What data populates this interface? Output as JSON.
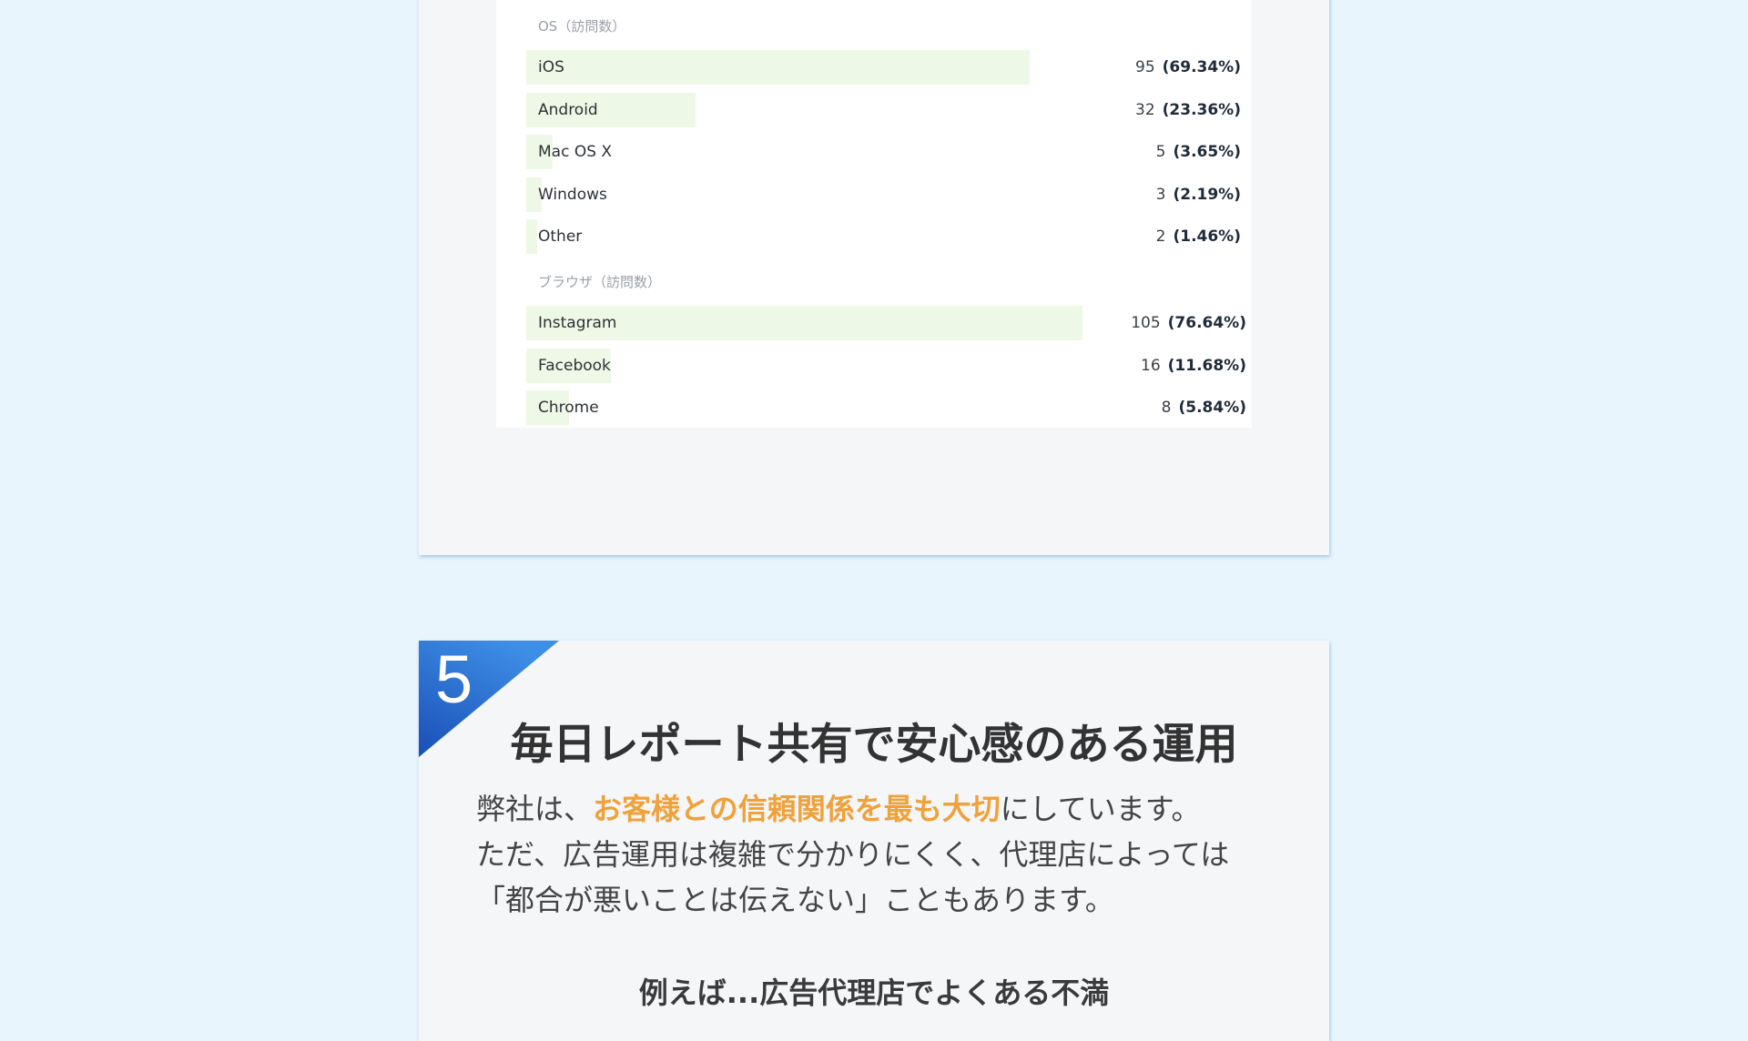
{
  "stats": {
    "os_label": "OS（訪問数）",
    "os_rows": [
      {
        "name": "iOS",
        "count": "95",
        "pct": "(69.34%)",
        "share": 0.6934
      },
      {
        "name": "Android",
        "count": "32",
        "pct": "(23.36%)",
        "share": 0.2336
      },
      {
        "name": "Mac OS X",
        "count": "5",
        "pct": "(3.65%)",
        "share": 0.0365
      },
      {
        "name": "Windows",
        "count": "3",
        "pct": "(2.19%)",
        "share": 0.0219
      },
      {
        "name": "Other",
        "count": "2",
        "pct": "(1.46%)",
        "share": 0.0146
      }
    ],
    "browser_label": "ブラウザ（訪問数）",
    "browser_rows": [
      {
        "name": "Instagram",
        "count": "105",
        "pct": "(76.64%)",
        "share": 0.7664
      },
      {
        "name": "Facebook",
        "count": "16",
        "pct": "(11.68%)",
        "share": 0.1168
      },
      {
        "name": "Chrome",
        "count": "8",
        "pct": "(5.84%)",
        "share": 0.0584
      }
    ]
  },
  "feature": {
    "number": "5",
    "title": "毎日レポート共有で安心感のある運用",
    "body_prefix": "弊社は、",
    "body_highlight": "お客様との信頼関係を最も大切",
    "body_suffix": "にしています。",
    "body_line2": "ただ、広告運用は複雑で分かりにくく、代理店によっては",
    "body_line3": "「都合が悪いことは伝えない」こともあります。",
    "subheading": "例えば...広告代理店でよくある不満"
  },
  "colors": {
    "background": "#e9f5fd",
    "bar": "#eef8e6",
    "badge_top": "#3d8ee6",
    "badge_bottom": "#1a4fb5",
    "highlight": "#f0a13a"
  }
}
